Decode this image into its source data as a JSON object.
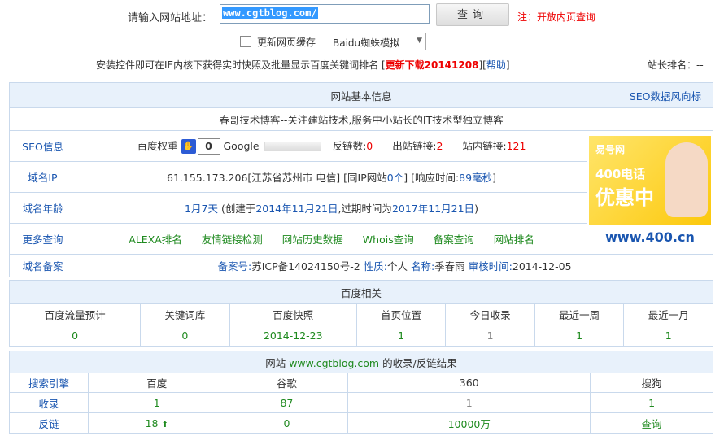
{
  "header": {
    "url_label": "请输入网站地址：",
    "url_value": "www.cgtblog.com/",
    "query_button": "查询",
    "note": "注：开放内页查询",
    "refresh_cache": "更新网页缓存",
    "spider_select": "Baidu蜘蛛模拟",
    "install_text": "安装控件即可在IE内核下获得实时快照及批量显示百度关键词排名",
    "download_link": "更新下载20141208",
    "help_link": "帮助",
    "rank_label": "站长排名：--"
  },
  "basic": {
    "title": "网站基本信息",
    "seo_link": "SEO数据风向标",
    "site_desc": "春哥技术博客--关注建站技术,服务中小站长的IT技术型独立博客",
    "seo_label": "SEO信息",
    "baidu_weight_label": "百度权重",
    "baidu_weight_value": "0",
    "google_label": "Google",
    "backlinks_label": "反链数:",
    "backlinks_value": "0",
    "outlinks_label": "出站链接:",
    "outlinks_value": "2",
    "inlinks_label": "站内链接:",
    "inlinks_value": "121",
    "domain_ip_label": "域名IP",
    "ip_value": "61.155.173.206[江苏省苏州市 电信]",
    "same_ip_prefix": "[同IP网站",
    "same_ip_count": "0个",
    "same_ip_suffix": "]",
    "response_prefix": "[响应时间:",
    "response_value": "89毫秒",
    "response_suffix": "]",
    "age_label": "域名年龄",
    "age_value": "1月7天",
    "created_prefix": "(创建于",
    "created_date": "2014年11月21日",
    "expire_prefix": ",过期时间为",
    "expire_date": "2017年11月21日",
    "expire_suffix": ")",
    "more_label": "更多查询",
    "more_links": [
      "ALEXA排名",
      "友情链接检测",
      "网站历史数据",
      "Whois查询",
      "备案查询",
      "网站排名"
    ],
    "icp_label": "域名备案",
    "icp_no_label": "备案号:",
    "icp_no": "苏ICP备14024150号-2",
    "nature_label": "性质:",
    "nature": "个人",
    "name_label": "名称:",
    "name": "季春雨",
    "audit_label": "审核时间:",
    "audit_date": "2014-12-05",
    "ad": {
      "brand": "易号网",
      "line1": "400电话",
      "line2": "优惠中",
      "url": "www.400.cn"
    }
  },
  "baidu": {
    "title": "百度相关",
    "headers": [
      "百度流量预计",
      "关键词库",
      "百度快照",
      "首页位置",
      "今日收录",
      "最近一周",
      "最近一月"
    ],
    "values": [
      "0",
      "0",
      "2014-12-23",
      "1",
      "1",
      "1",
      "1"
    ]
  },
  "index": {
    "title_prefix": "网站",
    "title_site": "www.cgtblog.com",
    "title_suffix": "的收录/反链结果",
    "headers": [
      "搜索引擎",
      "百度",
      "谷歌",
      "360",
      "搜狗"
    ],
    "rows": [
      {
        "label": "收录",
        "values": [
          "1",
          "87",
          "1",
          "1"
        ]
      },
      {
        "label": "反链",
        "values": [
          "18",
          "0",
          "10000万",
          "查询"
        ]
      }
    ]
  },
  "colors": {
    "accent": "#1a56b0",
    "red": "#e00000",
    "green": "#1f8a1f",
    "header_bg": "#e8f1fb",
    "border": "#c9d9ec"
  }
}
